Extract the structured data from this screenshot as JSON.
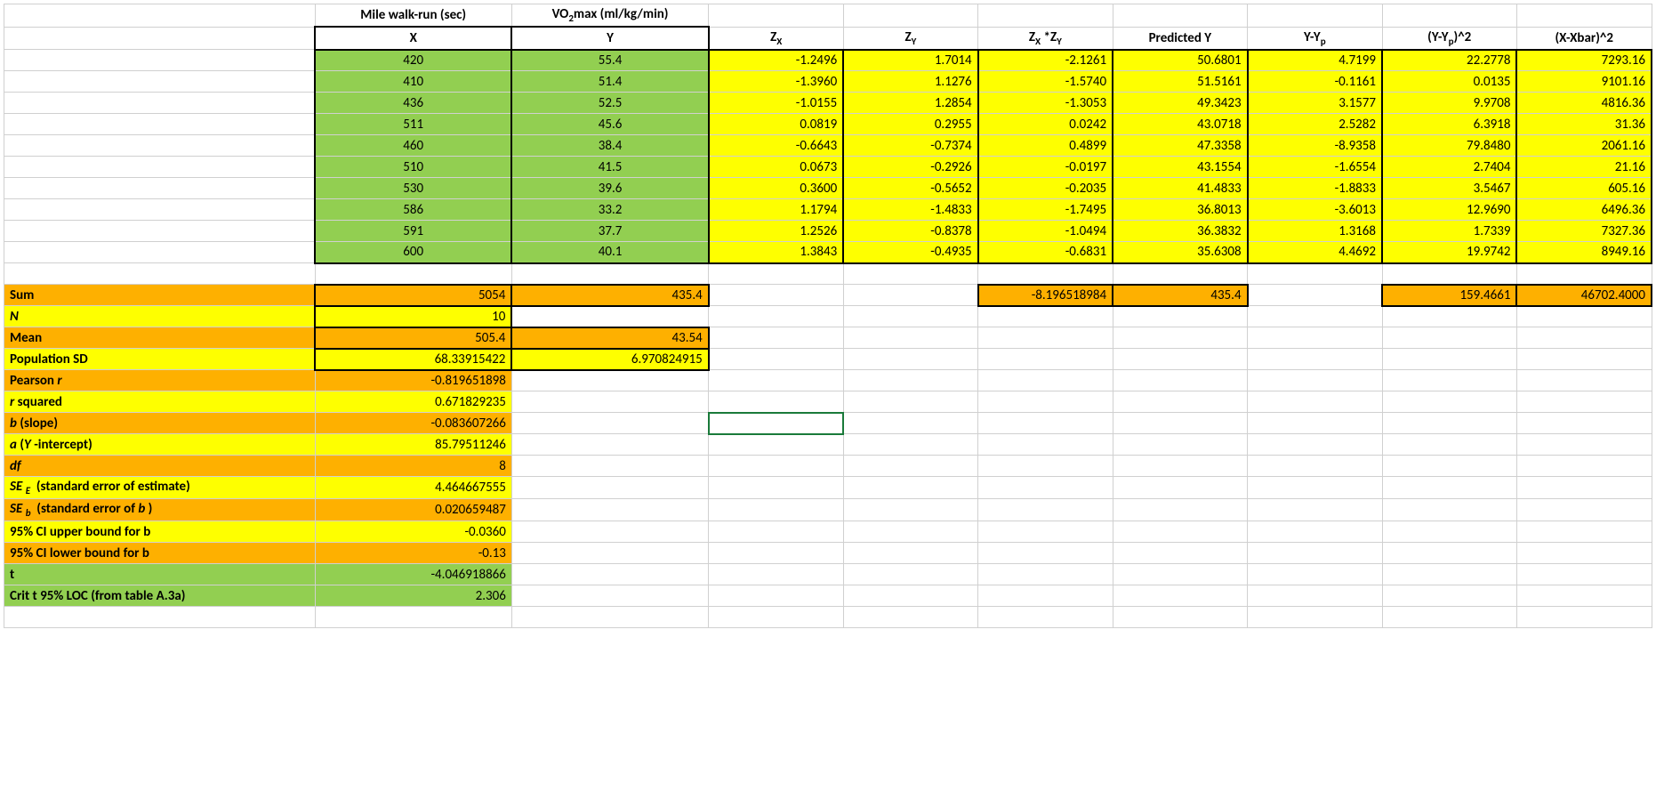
{
  "headers_row1": {
    "c2": "Mile walk-run (sec)",
    "c3_html": "VO<sub>2</sub>max (ml/kg/min)"
  },
  "headers_row2": {
    "c2": "X",
    "c3": "Y",
    "c4_html": "Z<sub>X</sub>",
    "c5_html": "Z<sub>Y</sub>",
    "c6_html": "Z<sub>X</sub> *Z<sub>Y</sub>",
    "c7": "Predicted Y",
    "c8_html": "Y-Y<sub>p</sub>",
    "c9_html": "(Y-Y<sub>p</sub>)^2",
    "c10": "(X-Xbar)^2"
  },
  "rows": [
    {
      "x": "420",
      "y": "55.4",
      "zx": "-1.2496",
      "zy": "1.7014",
      "zxzy": "-2.1261",
      "py": "50.6801",
      "yyp": "4.7199",
      "yyp2": "22.2778",
      "xxb": "7293.16"
    },
    {
      "x": "410",
      "y": "51.4",
      "zx": "-1.3960",
      "zy": "1.1276",
      "zxzy": "-1.5740",
      "py": "51.5161",
      "yyp": "-0.1161",
      "yyp2": "0.0135",
      "xxb": "9101.16"
    },
    {
      "x": "436",
      "y": "52.5",
      "zx": "-1.0155",
      "zy": "1.2854",
      "zxzy": "-1.3053",
      "py": "49.3423",
      "yyp": "3.1577",
      "yyp2": "9.9708",
      "xxb": "4816.36"
    },
    {
      "x": "511",
      "y": "45.6",
      "zx": "0.0819",
      "zy": "0.2955",
      "zxzy": "0.0242",
      "py": "43.0718",
      "yyp": "2.5282",
      "yyp2": "6.3918",
      "xxb": "31.36"
    },
    {
      "x": "460",
      "y": "38.4",
      "zx": "-0.6643",
      "zy": "-0.7374",
      "zxzy": "0.4899",
      "py": "47.3358",
      "yyp": "-8.9358",
      "yyp2": "79.8480",
      "xxb": "2061.16"
    },
    {
      "x": "510",
      "y": "41.5",
      "zx": "0.0673",
      "zy": "-0.2926",
      "zxzy": "-0.0197",
      "py": "43.1554",
      "yyp": "-1.6554",
      "yyp2": "2.7404",
      "xxb": "21.16"
    },
    {
      "x": "530",
      "y": "39.6",
      "zx": "0.3600",
      "zy": "-0.5652",
      "zxzy": "-0.2035",
      "py": "41.4833",
      "yyp": "-1.8833",
      "yyp2": "3.5467",
      "xxb": "605.16"
    },
    {
      "x": "586",
      "y": "33.2",
      "zx": "1.1794",
      "zy": "-1.4833",
      "zxzy": "-1.7495",
      "py": "36.8013",
      "yyp": "-3.6013",
      "yyp2": "12.9690",
      "xxb": "6496.36"
    },
    {
      "x": "591",
      "y": "37.7",
      "zx": "1.2526",
      "zy": "-0.8378",
      "zxzy": "-1.0494",
      "py": "36.3832",
      "yyp": "1.3168",
      "yyp2": "1.7339",
      "xxb": "7327.36"
    },
    {
      "x": "600",
      "y": "40.1",
      "zx": "1.3843",
      "zy": "-0.4935",
      "zxzy": "-0.6831",
      "py": "35.6308",
      "yyp": "4.4692",
      "yyp2": "19.9742",
      "xxb": "8949.16"
    }
  ],
  "sum": {
    "label": "Sum",
    "x": "5054",
    "y": "435.4",
    "zxzy": "-8.196518984",
    "py": "435.4",
    "yyp2": "159.4661",
    "xxb": "46702.4000"
  },
  "stats": [
    {
      "label_html": "<i>N</i>",
      "bg": "yellow",
      "xbg": "yellow",
      "x": "10",
      "xthick": true
    },
    {
      "label_html": "Mean",
      "bg": "orange",
      "xbg": "orange",
      "x": "505.4",
      "y": "43.54",
      "xthick": true,
      "ythick": true
    },
    {
      "label_html": "Population SD",
      "bg": "yellow",
      "xbg": "yellow",
      "x": "68.33915422",
      "y": "6.970824915",
      "xthick": true,
      "ythick": true
    },
    {
      "label_html": "Pearson <i>r</i>",
      "bg": "orange",
      "xbg": "orange",
      "x": "-0.819651898"
    },
    {
      "label_html": "<i>r</i> squared",
      "bg": "yellow",
      "xbg": "yellow",
      "x": "0.671829235"
    },
    {
      "label_html": "<i>b</i> (slope)",
      "bg": "orange",
      "xbg": "orange",
      "x": "-0.083607266"
    },
    {
      "label_html": "<i>a</i>  (<i>Y</i> -intercept)",
      "bg": "yellow",
      "xbg": "yellow",
      "x": "85.79511246"
    },
    {
      "label_html": "<i>df</i>",
      "bg": "orange",
      "xbg": "orange",
      "x": "8"
    },
    {
      "label_html": "<i>SE</i> <sub><i>E</i></sub>&nbsp; (standard error of estimate)",
      "bg": "yellow",
      "xbg": "yellow",
      "x": "4.464667555"
    },
    {
      "label_html": "<i>SE</i> <sub><i>b</i></sub>&nbsp; (standard error of <i>b</i> )",
      "bg": "orange",
      "xbg": "orange",
      "x": "0.020659487"
    },
    {
      "label_html": "95% CI upper bound for b",
      "bg": "yellow",
      "xbg": "yellow",
      "x": "-0.0360"
    },
    {
      "label_html": "95% CI lower bound for b",
      "bg": "orange",
      "xbg": "orange",
      "x": "-0.13"
    },
    {
      "label_html": "t",
      "bg": "green",
      "xbg": "green",
      "x": "-4.046918866"
    },
    {
      "label_html": "Crit t 95% LOC (from table A.3a)",
      "bg": "green",
      "xbg": "green",
      "x": "2.306"
    }
  ]
}
